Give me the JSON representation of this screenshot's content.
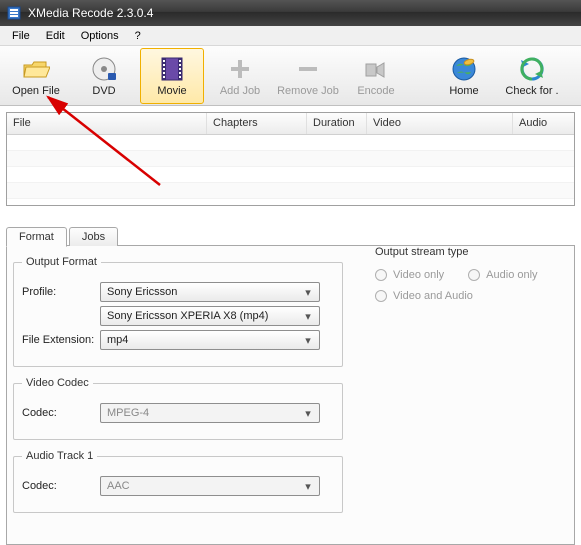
{
  "window": {
    "title": "XMedia Recode 2.3.0.4"
  },
  "menu": {
    "file": "File",
    "edit": "Edit",
    "options": "Options",
    "help": "?"
  },
  "toolbar": {
    "open_file": "Open File",
    "dvd": "DVD",
    "movie": "Movie",
    "add_job": "Add Job",
    "remove_job": "Remove Job",
    "encode": "Encode",
    "home": "Home",
    "check": "Check for ."
  },
  "filelist": {
    "cols": {
      "file": "File",
      "chapters": "Chapters",
      "duration": "Duration",
      "video": "Video",
      "audio": "Audio"
    }
  },
  "tabs": {
    "format": "Format",
    "jobs": "Jobs"
  },
  "format": {
    "output_legend": "Output Format",
    "profile_label": "Profile:",
    "profile_value": "Sony Ericsson",
    "profile_sub": "Sony Ericsson XPERIA X8 (mp4)",
    "ext_label": "File Extension:",
    "ext_value": "mp4",
    "video_legend": "Video Codec",
    "video_codec_label": "Codec:",
    "video_codec_value": "MPEG-4",
    "audio_legend": "Audio Track 1",
    "audio_codec_label": "Codec:",
    "audio_codec_value": "AAC",
    "stream_legend": "Output stream type",
    "stream_video_only": "Video only",
    "stream_audio_only": "Audio only",
    "stream_video_and_audio": "Video and Audio"
  }
}
